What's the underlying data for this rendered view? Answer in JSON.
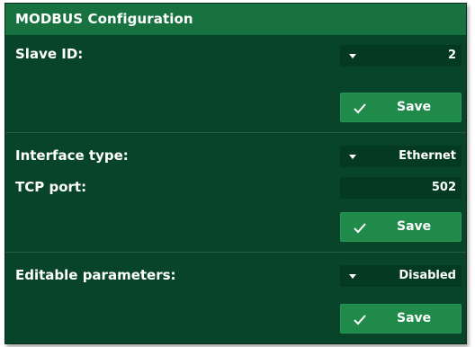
{
  "panel": {
    "title": "MODBUS Configuration"
  },
  "slave": {
    "label": "Slave ID:",
    "value": "2",
    "save_label": "Save"
  },
  "interface": {
    "type_label": "Interface type:",
    "type_value": "Ethernet",
    "port_label": "TCP port:",
    "port_value": "502",
    "save_label": "Save"
  },
  "editable": {
    "label": "Editable parameters:",
    "value": "Disabled",
    "save_label": "Save"
  },
  "colors": {
    "panel_bg": "#08442a",
    "header_bg": "#17723f",
    "button_bg": "#1f8a4a",
    "field_bg": "#053a22"
  },
  "icons": {
    "dropdown": "caret-down-icon",
    "save": "check-icon"
  }
}
